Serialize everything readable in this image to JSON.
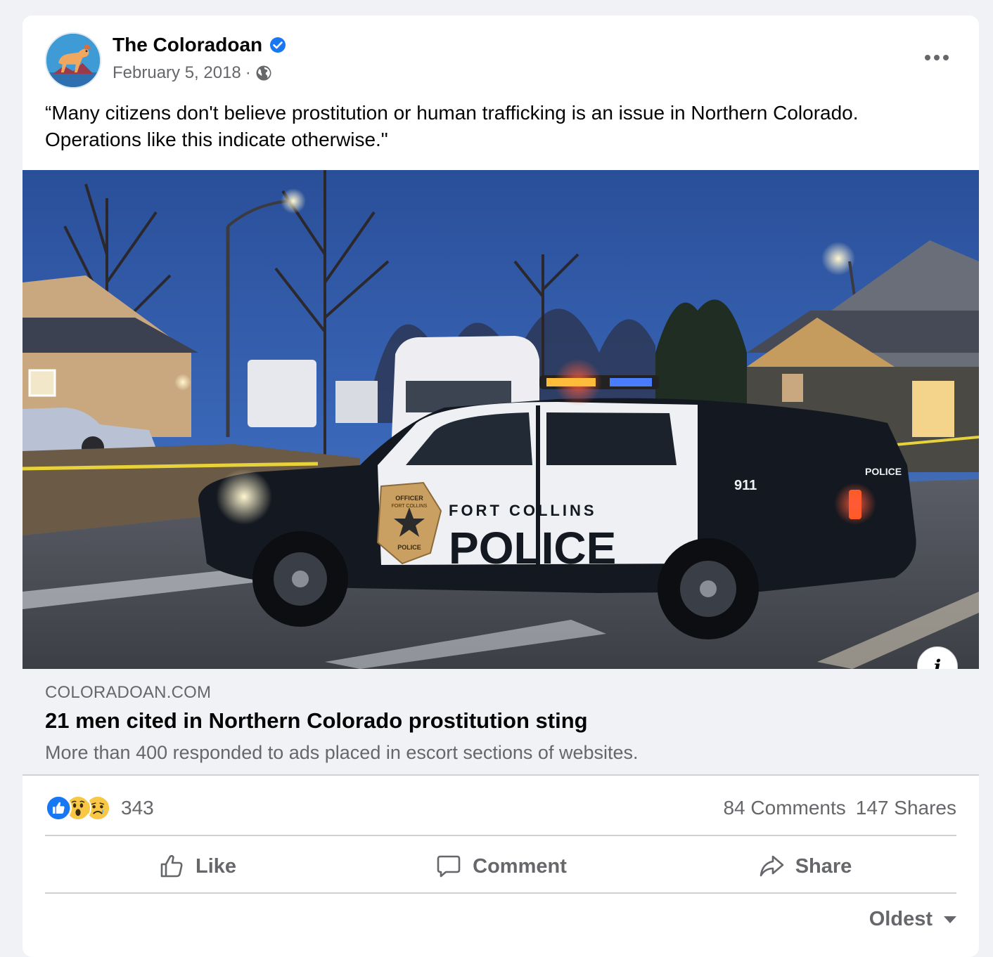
{
  "post": {
    "page_name": "The Coloradoan",
    "date": "February 5, 2018",
    "separator": "·",
    "text_line1": "“Many citizens don't believe prostitution or human trafficking is an issue in Northern Colorado.",
    "text_line2": "Operations like this indicate otherwise.\""
  },
  "photo": {
    "door_text": "FORT COLLINS",
    "door_big": "POLICE",
    "unit_number": "911",
    "rear_text": "POLICE",
    "badge_top": "OFFICER",
    "badge_mid": "FORT COLLINS",
    "badge_bot": "POLICE",
    "info_label": "i"
  },
  "link": {
    "domain": "COLORADOAN.COM",
    "title": "21 men cited in Northern Colorado prostitution sting",
    "description": "More than 400 responded to ads placed in escort sections of websites."
  },
  "stats": {
    "reaction_count": "343",
    "comments": "84 Comments",
    "shares": "147 Shares"
  },
  "actions": {
    "like": "Like",
    "comment": "Comment",
    "share": "Share"
  },
  "sort": {
    "label": "Oldest"
  },
  "colors": {
    "accent_blue": "#1877f2",
    "secondary_text": "#65676b",
    "background": "#f0f2f5"
  },
  "icons": [
    "verified-badge-icon",
    "globe-icon",
    "more-options-icon",
    "info-icon",
    "like-reaction-icon",
    "wow-reaction-icon",
    "sad-reaction-icon",
    "thumbs-up-icon",
    "comment-icon",
    "share-arrow-icon",
    "caret-down-icon"
  ]
}
